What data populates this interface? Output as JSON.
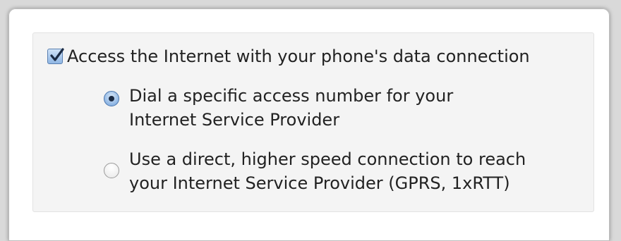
{
  "checkbox": {
    "label": "Access the Internet with your phone's data connection",
    "checked": true
  },
  "options": [
    {
      "line1": "Dial a specific access number for your",
      "line2": "Internet Service Provider",
      "selected": true
    },
    {
      "line1": "Use a direct, higher speed connection to reach",
      "line2": "your Internet Service Provider (GPRS, 1xRTT)",
      "selected": false
    }
  ],
  "colors": {
    "accent": "#8fb6e4",
    "text": "#222222",
    "group_background": "#f4f4f4"
  }
}
